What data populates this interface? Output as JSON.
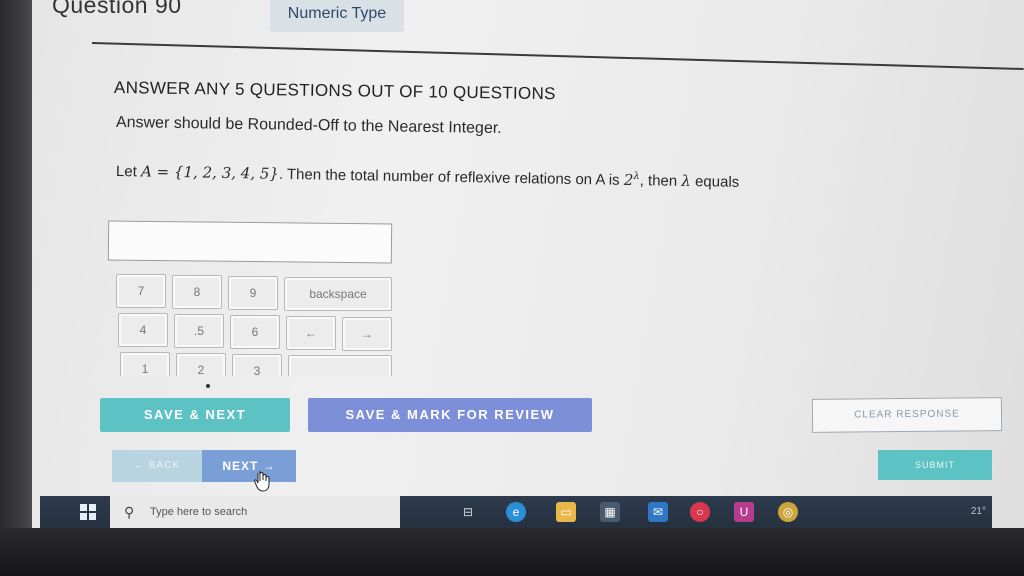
{
  "header": {
    "question_number": "Question 90",
    "question_type": "Numeric Type"
  },
  "question": {
    "instructions": "ANSWER ANY 5 QUESTIONS OUT OF 10 QUESTIONS",
    "rounding_note": "Answer should be Rounded-Off to the Nearest Integer.",
    "text_prefix": "Let",
    "set_name": "A",
    "set_value": " = {1, 2, 3, 4, 5}",
    "text_middle": ". Then the total number of reflexive relations on A is ",
    "power_base": "2",
    "power_exponent": "λ",
    "text_end": ", then ",
    "lambda": "λ",
    "text_suffix": " equals"
  },
  "answer": {
    "value": ""
  },
  "keypad": {
    "row1": [
      "7",
      "8",
      "9"
    ],
    "backspace": "backspace",
    "row2": [
      "4",
      ".5",
      "6"
    ],
    "left_arrow": "←",
    "right_arrow": "→",
    "row3": [
      "1",
      "2",
      "3"
    ]
  },
  "actions": {
    "save_next": "SAVE & NEXT",
    "save_mark_review": "SAVE & MARK FOR REVIEW",
    "clear_response": "CLEAR RESPONSE",
    "back": "← BACK",
    "next": "NEXT →",
    "submit": "SUBMIT"
  },
  "taskbar": {
    "search_placeholder": "Type here to search",
    "tray_text": "21°"
  },
  "colors": {
    "teal": "#5cc2c3",
    "purple": "#7e8fd9",
    "next_blue": "#7a9ed6",
    "taskbar": "#2e3b4e"
  }
}
